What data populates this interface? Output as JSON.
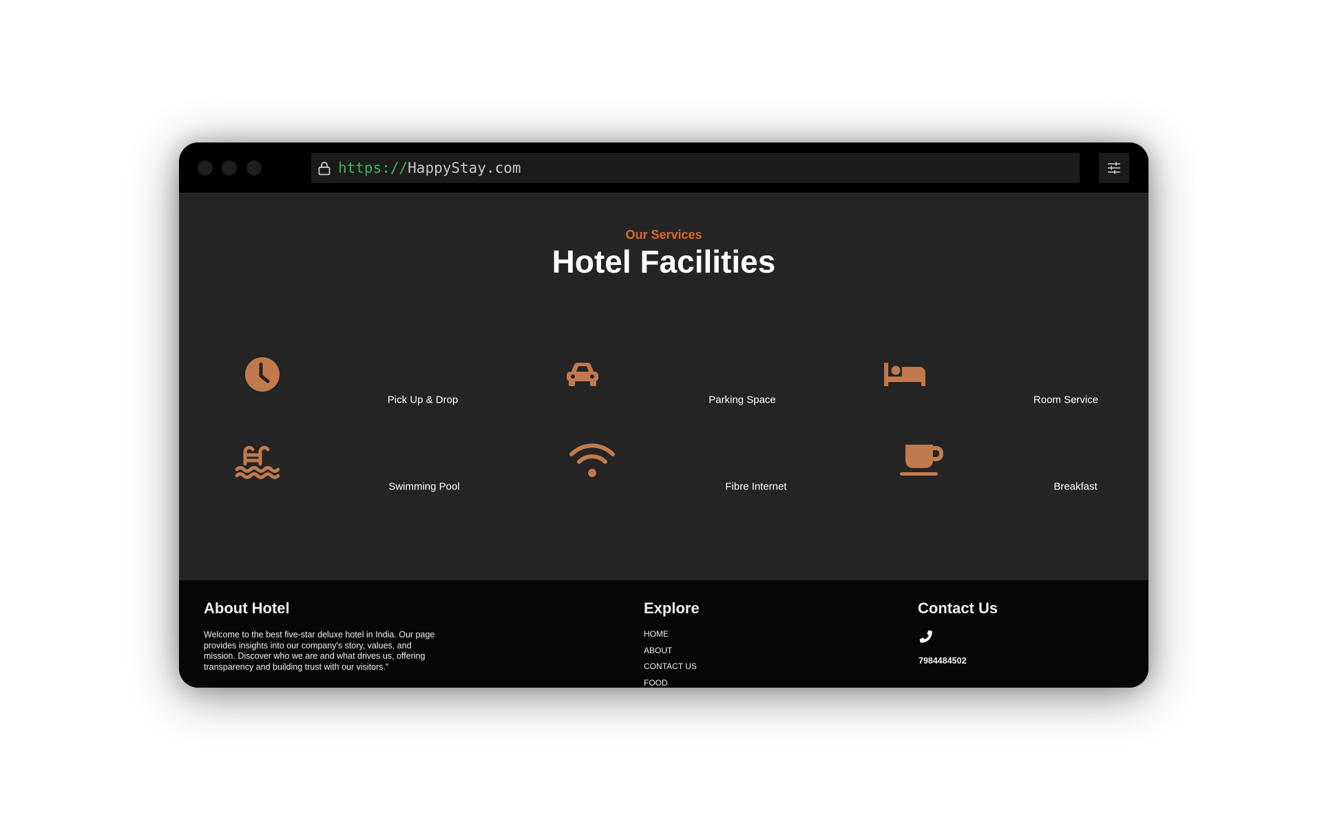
{
  "browser": {
    "url_protocol": "https://",
    "url_host": "HappyStay.com",
    "icons": {
      "lock": "lock-icon",
      "menu": "sliders-icon"
    }
  },
  "services": {
    "eyebrow": "Our Services",
    "title": "Hotel Facilities",
    "accent_color": "#c17a4e",
    "items": [
      {
        "label": "Pick Up & Drop",
        "icon": "clock-icon"
      },
      {
        "label": "Parking Space",
        "icon": "car-icon"
      },
      {
        "label": "Room Service",
        "icon": "bed-icon"
      },
      {
        "label": "Swimming Pool",
        "icon": "swimming-pool-icon"
      },
      {
        "label": "Fibre Internet",
        "icon": "wifi-icon"
      },
      {
        "label": "Breakfast",
        "icon": "coffee-cup-icon"
      }
    ]
  },
  "footer": {
    "about": {
      "title": "About Hotel",
      "text": "Welcome to the best five-star deluxe hotel in India. Our page provides insights into our company's story, values, and mission. Discover who we are and what drives us, offering transparency and building trust with our visitors.\""
    },
    "explore": {
      "title": "Explore",
      "links": [
        "HOME",
        "ABOUT",
        "CONTACT US",
        "FOOD"
      ]
    },
    "contact": {
      "title": "Contact Us",
      "phone_icon": "phone-icon",
      "phone": "7984484502"
    }
  }
}
